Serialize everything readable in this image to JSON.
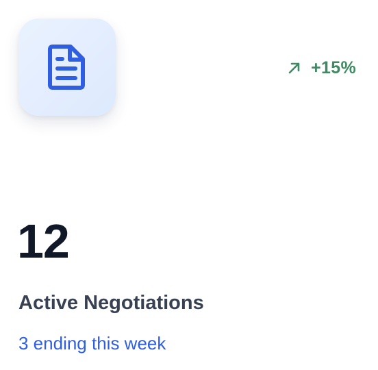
{
  "card": {
    "icon": "document-icon",
    "trend": {
      "icon": "arrow-up-right-icon",
      "value": "+15%",
      "color": "#3f8a62"
    },
    "value": "12",
    "label": "Active Negotiations",
    "subtext": "3 ending this week",
    "colors": {
      "accent": "#2f5fe0",
      "icon_tile_bg": "#e4eefe",
      "value_text": "#111827",
      "label_text": "#374151"
    }
  }
}
